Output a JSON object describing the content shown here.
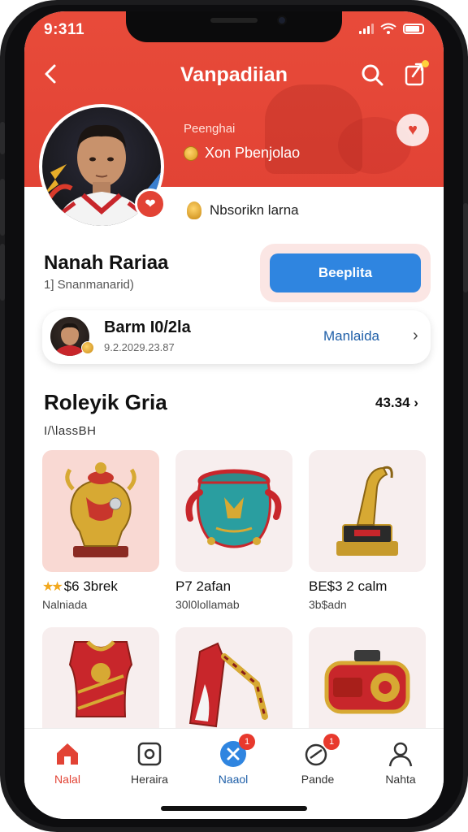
{
  "status_bar": {
    "time": "9:311"
  },
  "header": {
    "title": "Vanpadiian"
  },
  "profile": {
    "tag": "Peenghai",
    "subtitle": "Xon Pbenjolao",
    "fan_line": "Nbsorikn larna",
    "name": "Nanah Rariaa",
    "handle": "1] Snanmanarid)",
    "cta_label": "Beeplita"
  },
  "team_card": {
    "name": "Barm I0/2la",
    "id": "9.2.2029.23.87",
    "link": "Manlaida"
  },
  "section": {
    "title": "Roleyik Gria",
    "count": "43.34",
    "subtitle": "I/\\lassBH"
  },
  "items": [
    {
      "name": "$6 3brek",
      "sub": "Nalniada",
      "rating": 2
    },
    {
      "name": "P7 2afan",
      "sub": "30l0lollamab",
      "rating": 0
    },
    {
      "name": "BE$3 2 calm",
      "sub": "3b$adn",
      "rating": 0
    },
    {
      "name": "",
      "sub": "",
      "rating": 0
    },
    {
      "name": "",
      "sub": "",
      "rating": 0
    },
    {
      "name": "",
      "sub": "",
      "rating": 0
    }
  ],
  "tabbar": [
    {
      "label": "Nalal",
      "icon": "home-icon",
      "active": true
    },
    {
      "label": "Heraira",
      "icon": "square-icon",
      "active": false
    },
    {
      "label": "Naaol",
      "icon": "x-circle-icon",
      "active": false,
      "badge": "1"
    },
    {
      "label": "Pande",
      "icon": "chat-icon",
      "active": false,
      "badge": "1"
    },
    {
      "label": "Nahta",
      "icon": "person-icon",
      "active": false
    }
  ],
  "colors": {
    "brand": "#e24335",
    "cta": "#2f85e0",
    "badge": "#e8392d"
  }
}
